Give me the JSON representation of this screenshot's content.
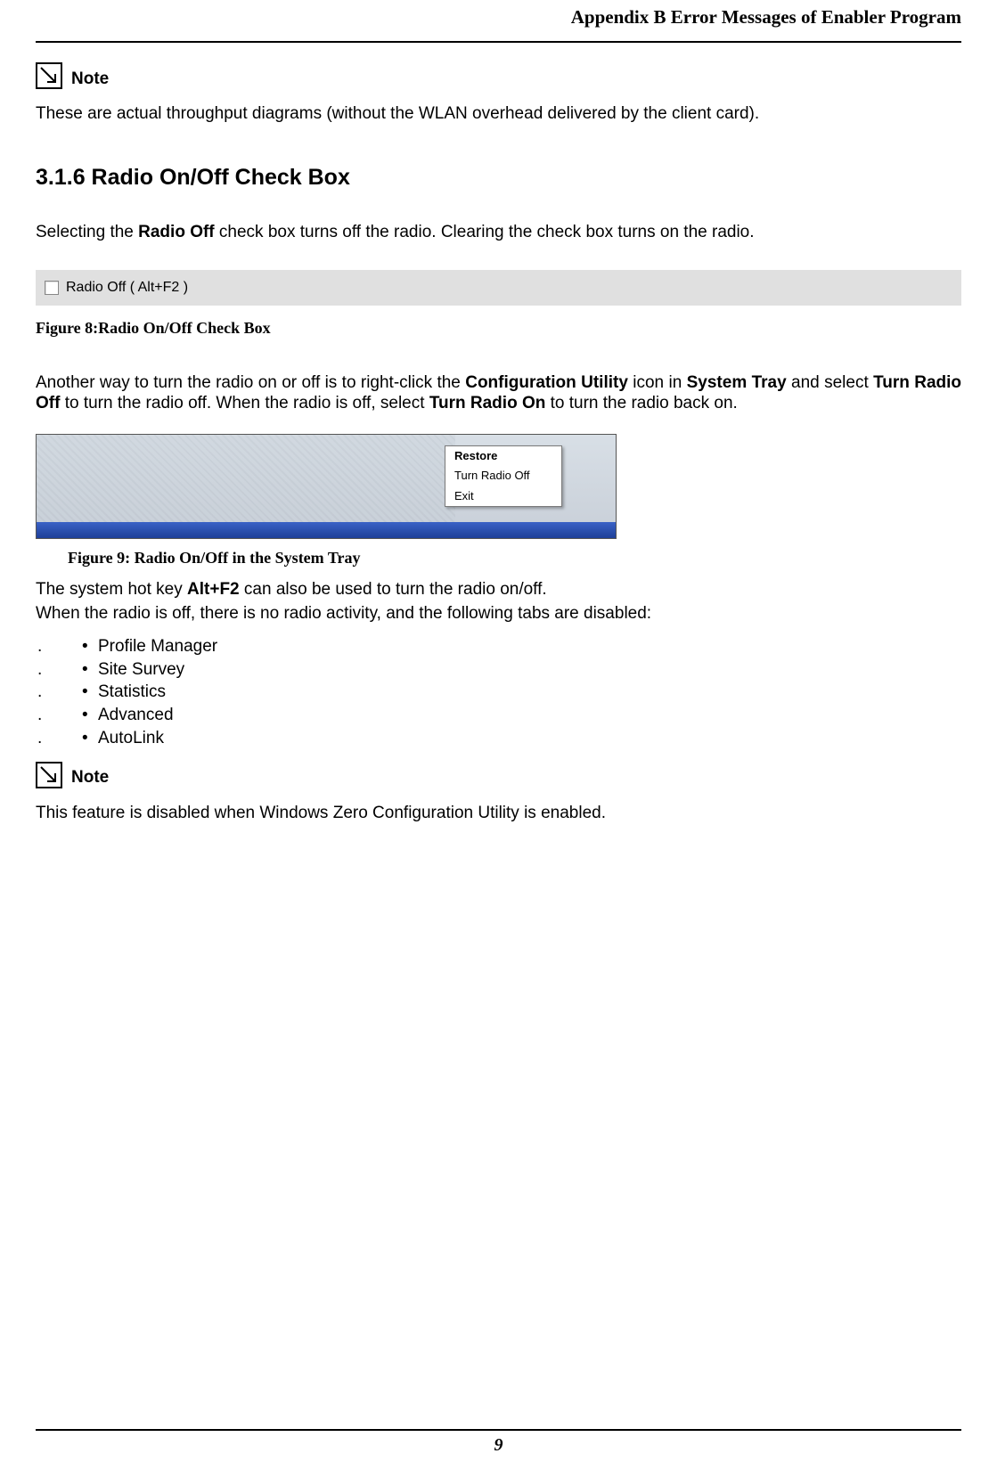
{
  "header": {
    "appendix_title": "Appendix B Error Messages of Enabler Program"
  },
  "note1": {
    "label": "Note",
    "text": "These are actual throughput diagrams (without the WLAN overhead delivered by the client card)."
  },
  "section_316": {
    "heading": "3.1.6 Radio On/Off Check Box",
    "intro_pre": "Selecting the ",
    "intro_bold": "Radio Off",
    "intro_post": " check box turns off the radio. Clearing the check box turns on the radio.",
    "checkbox_label": "Radio Off  ( Alt+F2 )",
    "figure8": "Figure 8:Radio On/Off Check Box",
    "p2_seg1": "Another way to turn the radio on or off is to right-click the ",
    "p2_b1": "Configuration Utility",
    "p2_seg2": " icon in ",
    "p2_b2": "System Tray",
    "p2_seg3": " and select ",
    "p2_b3": "Turn Radio Off",
    "p2_seg4": " to turn the radio off. When the radio is off, select ",
    "p2_b4": "Turn Radio On",
    "p2_seg5": " to turn the radio back on.",
    "context_menu": {
      "restore": "Restore",
      "turn_off": "Turn Radio Off",
      "exit": "Exit"
    },
    "figure9": "Figure 9: Radio On/Off in the System Tray",
    "hotkey_seg1": "The system hot key ",
    "hotkey_bold": "Alt+F2",
    "hotkey_seg2": " can also be used to turn the radio on/off.",
    "disabled_intro": "When the radio is off, there is no radio activity, and the following tabs are disabled:",
    "disabled_tabs": {
      "0": "Profile Manager",
      "1": "Site Survey",
      "2": "Statistics",
      "3": "Advanced",
      "4": "AutoLink"
    }
  },
  "note2": {
    "label": "Note",
    "text": "This feature is disabled when Windows Zero Configuration Utility is enabled."
  },
  "list_marker": ".",
  "bullet": "•",
  "footer": {
    "page_number": "9"
  }
}
